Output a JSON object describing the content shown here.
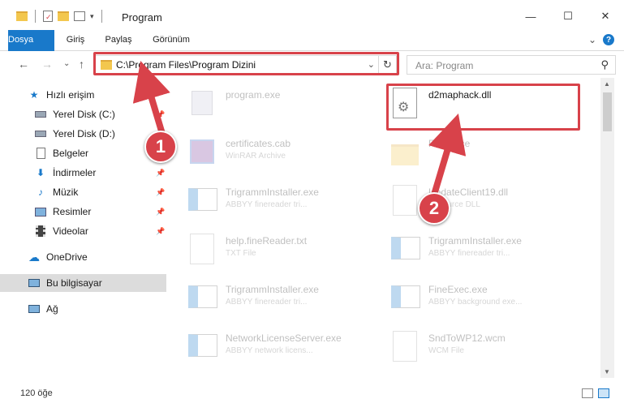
{
  "window": {
    "title": "Program",
    "minimize": "—",
    "maximize": "☐",
    "close": "✕"
  },
  "ribbon": {
    "tabs": [
      "Dosya",
      "Giriş",
      "Paylaş",
      "Görünüm"
    ],
    "expand": "⌄",
    "help": "?"
  },
  "nav": {
    "back": "←",
    "forward": "→",
    "recent": "⌄",
    "up": "↑",
    "address": "C:\\Program Files\\Program Dizini",
    "search_placeholder": "Ara: Program"
  },
  "sidebar": {
    "items": [
      {
        "label": "Hızlı erişim",
        "icon": "star-icon"
      },
      {
        "label": "Yerel Disk (C:)",
        "icon": "drive-icon"
      },
      {
        "label": "Yerel Disk (D:)",
        "icon": "drive-icon"
      },
      {
        "label": "Belgeler",
        "icon": "documents-icon"
      },
      {
        "label": "İndirmeler",
        "icon": "download-icon"
      },
      {
        "label": "Müzik",
        "icon": "music-icon"
      },
      {
        "label": "Resimler",
        "icon": "pictures-icon"
      },
      {
        "label": "Videolar",
        "icon": "video-icon"
      },
      {
        "label": "OneDrive",
        "icon": "cloud-icon"
      },
      {
        "label": "Bu bilgisayar",
        "icon": "computer-icon"
      },
      {
        "label": "Ağ",
        "icon": "network-icon"
      }
    ]
  },
  "files": [
    {
      "name": "program.exe",
      "type": ""
    },
    {
      "name": "d2maphack.dll",
      "type": ""
    },
    {
      "name": "certificates.cab",
      "type": "WinRAR Archive"
    },
    {
      "name": "Resource",
      "type": ""
    },
    {
      "name": "TrigrammInstaller.exe",
      "type": "ABBYY finereader tri..."
    },
    {
      "name": "UpdateClient19.dll",
      "type": "Resource DLL"
    },
    {
      "name": "help.fineReader.txt",
      "type": "TXT File"
    },
    {
      "name": "TrigrammInstaller.exe",
      "type": "ABBYY finereader tri..."
    },
    {
      "name": "TrigrammInstaller.exe",
      "type": "ABBYY finereader tri..."
    },
    {
      "name": "FineExec.exe",
      "type": "ABBYY background exe..."
    },
    {
      "name": "NetworkLicenseServer.exe",
      "type": "ABBYY network licens..."
    },
    {
      "name": "SndToWP12.wcm",
      "type": "WCM File"
    }
  ],
  "status": {
    "count": "120 öğe"
  },
  "markers": [
    "1",
    "2"
  ],
  "colors": {
    "accent": "#1979ca",
    "highlight": "#d8424a",
    "folder": "#f3c74e"
  }
}
